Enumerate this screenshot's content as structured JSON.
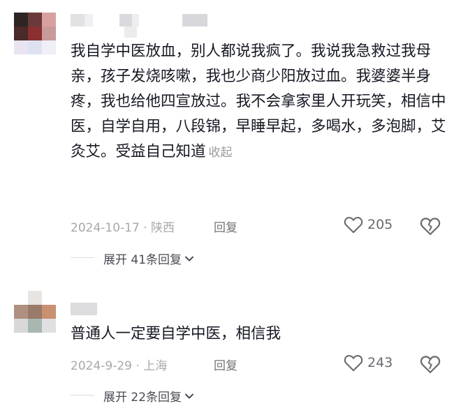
{
  "comments": [
    {
      "text": "我自学中医放血，别人都说我疯了。我说我急救过我母亲，孩子发烧咳嗽，我也少商少阳放过血。我婆婆半身疼，我也给他四宣放过。我不会拿家里人开玩笑，相信中医，自学自用，八段锦，早睡早起，多喝水，多泡脚，艾灸艾。受益自己知道",
      "collapse_label": "收起",
      "date_location": "2024-10-17 · 陕西",
      "reply_label": "回复",
      "likes": "205",
      "expand_label": "展开 41条回复"
    },
    {
      "text": "普通人一定要自学中医，相信我",
      "date_location": "2024-9-29 · 上海",
      "reply_label": "回复",
      "likes": "243",
      "expand_label": "展开 22条回复"
    }
  ],
  "icons": {
    "like": "heart-outline-icon",
    "dislike": "broken-heart-icon",
    "expand": "chevron-down-icon"
  },
  "colors": {
    "text": "#161823",
    "muted": "#a8a8ad",
    "action": "#6a6a70"
  }
}
